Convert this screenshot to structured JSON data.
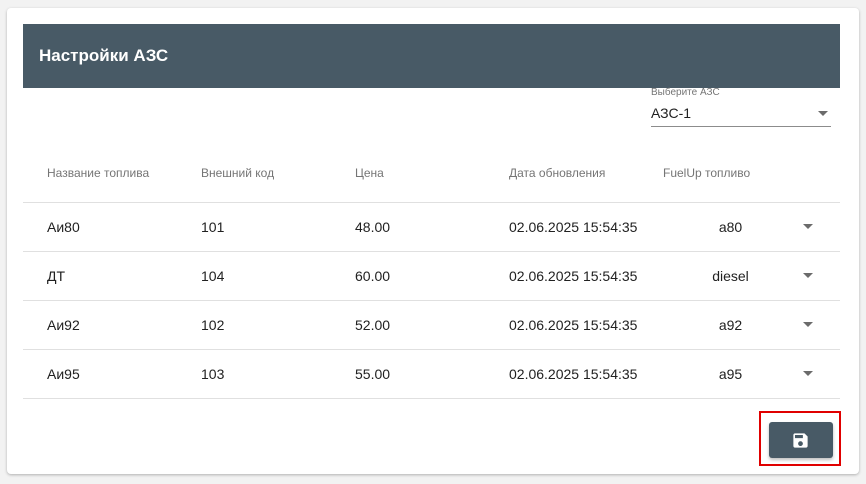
{
  "header": {
    "title": "Настройки АЗС"
  },
  "station_select": {
    "label": "Выберите АЗС",
    "value": "АЗС-1"
  },
  "table": {
    "columns": [
      "Название топлива",
      "Внешний код",
      "Цена",
      "Дата обновления",
      "FuelUp топливо"
    ],
    "rows": [
      {
        "name": "Аи80",
        "code": "101",
        "price": "48.00",
        "updated": "02.06.2025 15:54:35",
        "fuelup": "a80"
      },
      {
        "name": "ДТ",
        "code": "104",
        "price": "60.00",
        "updated": "02.06.2025 15:54:35",
        "fuelup": "diesel"
      },
      {
        "name": "Аи92",
        "code": "102",
        "price": "52.00",
        "updated": "02.06.2025 15:54:35",
        "fuelup": "a92"
      },
      {
        "name": "Аи95",
        "code": "103",
        "price": "55.00",
        "updated": "02.06.2025 15:54:35",
        "fuelup": "a95"
      }
    ]
  },
  "save_button": {
    "icon": "floppy-disk-icon"
  },
  "colors": {
    "header_bg": "#485a66",
    "button_bg": "#485a66",
    "highlight": "#e00000"
  }
}
